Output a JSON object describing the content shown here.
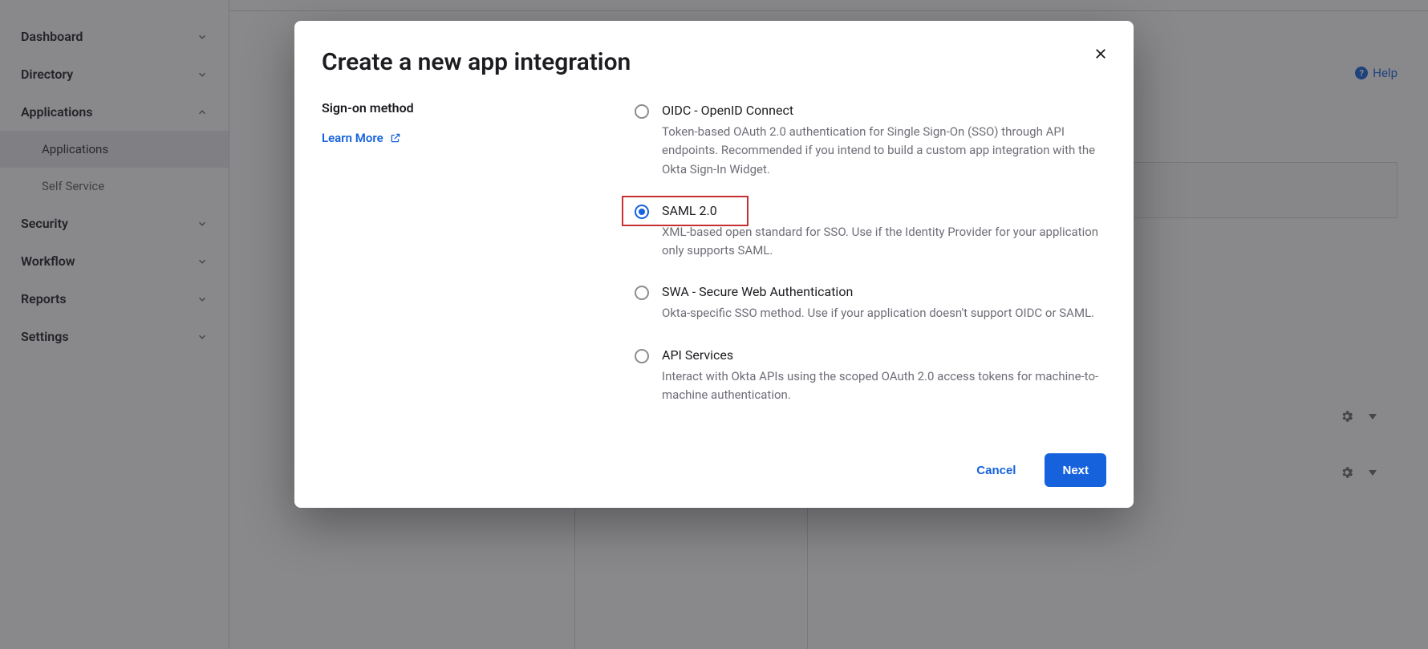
{
  "sidebar": {
    "items": [
      {
        "label": "Dashboard",
        "expanded": false
      },
      {
        "label": "Directory",
        "expanded": false
      },
      {
        "label": "Applications",
        "expanded": true,
        "children": [
          {
            "label": "Applications",
            "active": true
          },
          {
            "label": "Self Service",
            "active": false
          }
        ]
      },
      {
        "label": "Security",
        "expanded": false
      },
      {
        "label": "Workflow",
        "expanded": false
      },
      {
        "label": "Reports",
        "expanded": false
      },
      {
        "label": "Settings",
        "expanded": false
      }
    ]
  },
  "help_label": "Help",
  "modal": {
    "title": "Create a new app integration",
    "section_label": "Sign-on method",
    "learn_more": "Learn More",
    "options": [
      {
        "id": "oidc",
        "title": "OIDC - OpenID Connect",
        "desc": "Token-based OAuth 2.0 authentication for Single Sign-On (SSO) through API endpoints. Recommended if you intend to build a custom app integration with the Okta Sign-In Widget.",
        "selected": false
      },
      {
        "id": "saml",
        "title": "SAML 2.0",
        "desc": "XML-based open standard for SSO. Use if the Identity Provider for your application only supports SAML.",
        "selected": true,
        "highlight": true
      },
      {
        "id": "swa",
        "title": "SWA - Secure Web Authentication",
        "desc": "Okta-specific SSO method. Use if your application doesn't support OIDC or SAML.",
        "selected": false
      },
      {
        "id": "api",
        "title": "API Services",
        "desc": "Interact with Okta APIs using the scoped OAuth 2.0 access tokens for machine-to-machine authentication.",
        "selected": false
      }
    ],
    "cancel": "Cancel",
    "next": "Next"
  }
}
